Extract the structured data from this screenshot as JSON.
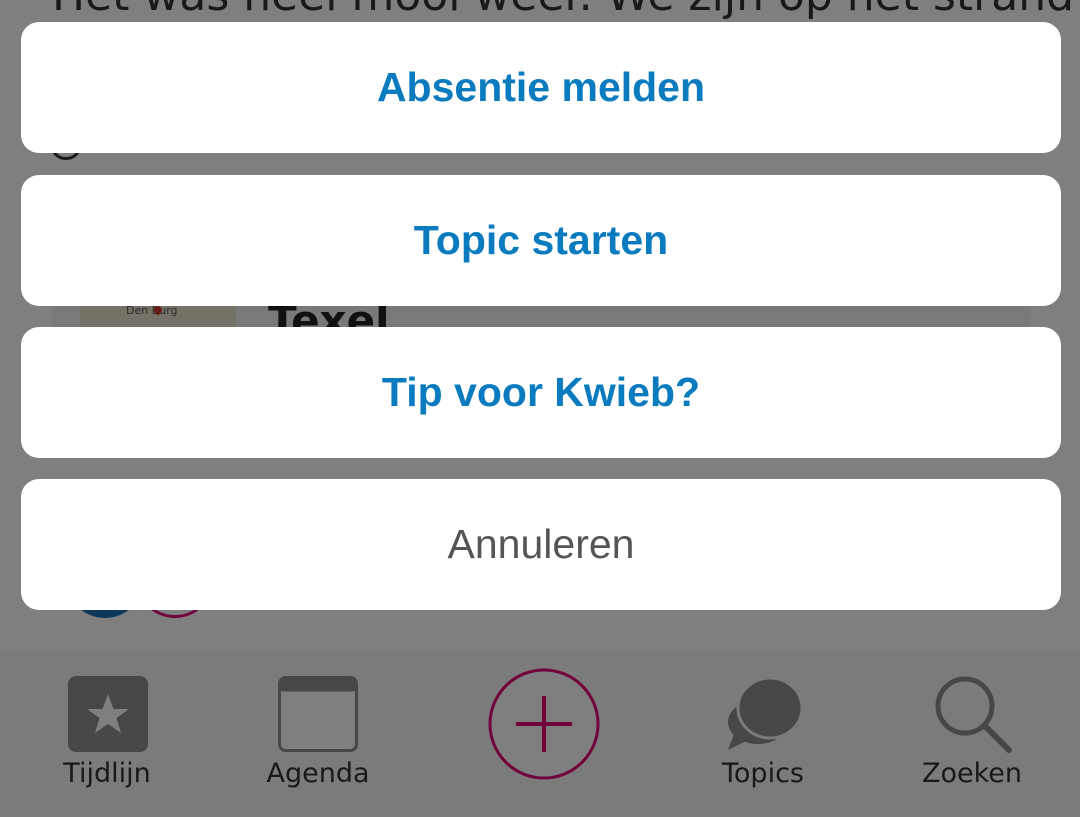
{
  "background": {
    "post_text": "Het was heel mooi weer. We zijn op het strand",
    "map_label": "Den Burg",
    "location": "Texel"
  },
  "action_sheet": {
    "items": [
      {
        "label": "Absentie melden",
        "style": "primary"
      },
      {
        "label": "Topic starten",
        "style": "primary"
      },
      {
        "label": "Tip voor Kwieb?",
        "style": "primary"
      }
    ],
    "cancel_label": "Annuleren"
  },
  "tabbar": {
    "tabs": [
      {
        "label": "Tijdlijn",
        "icon": "star-icon"
      },
      {
        "label": "Agenda",
        "icon": "calendar-icon"
      },
      {
        "label": "",
        "icon": "plus-icon"
      },
      {
        "label": "Topics",
        "icon": "chat-bubbles-icon"
      },
      {
        "label": "Zoeken",
        "icon": "search-icon"
      }
    ]
  },
  "colors": {
    "primary_text": "#0a7bbf",
    "cancel_text": "#555555",
    "accent": "#e2007a",
    "icon_gray": "#8e8e8e"
  }
}
